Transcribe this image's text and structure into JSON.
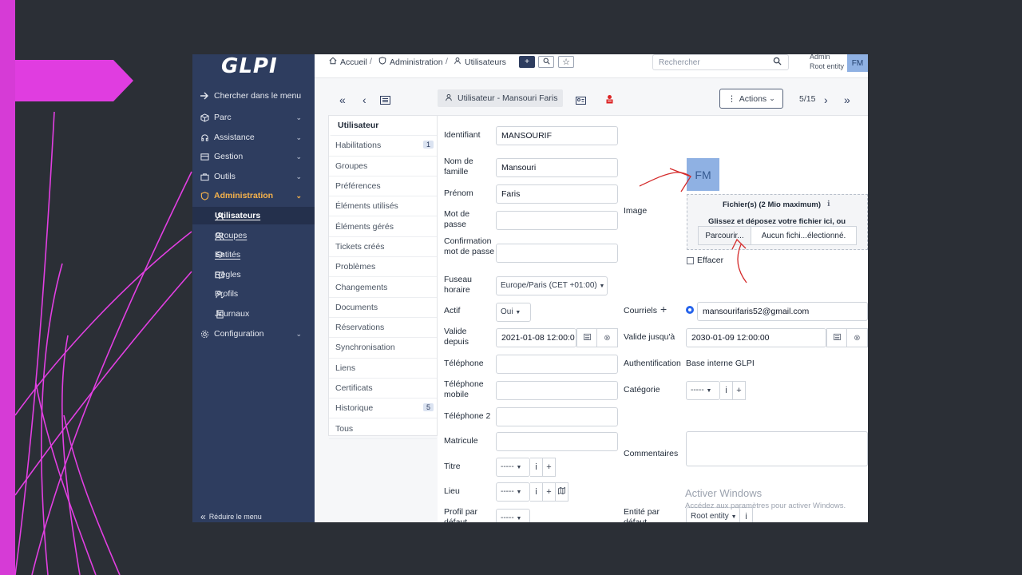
{
  "app": {
    "logo_text": "GLPI"
  },
  "sidebar": {
    "search_label": "Chercher dans le menu",
    "items": [
      {
        "label": "Parc"
      },
      {
        "label": "Assistance"
      },
      {
        "label": "Gestion"
      },
      {
        "label": "Outils"
      },
      {
        "label": "Administration"
      }
    ],
    "subitems": [
      {
        "label": "Utilisateurs"
      },
      {
        "label": "Groupes"
      },
      {
        "label": "Entités"
      },
      {
        "label": "Règles"
      },
      {
        "label": "Profils"
      },
      {
        "label": "Journaux"
      }
    ],
    "config_label": "Configuration",
    "collapse_label": "Réduire le menu"
  },
  "topbar": {
    "breadcrumb": [
      "Accueil",
      "Administration",
      "Utilisateurs"
    ],
    "add_icon": "+",
    "search_placeholder": "Rechercher",
    "user_name": "Admin",
    "user_entity": "Root entity",
    "avatar_initials": "FM"
  },
  "record": {
    "title": "Utilisateur - Mansouri Faris",
    "actions_label": "Actions",
    "pager": "5/15"
  },
  "tabs": [
    {
      "label": "Utilisateur",
      "badge": ""
    },
    {
      "label": "Habilitations",
      "badge": "1"
    },
    {
      "label": "Groupes",
      "badge": ""
    },
    {
      "label": "Préférences",
      "badge": ""
    },
    {
      "label": "Éléments utilisés",
      "badge": ""
    },
    {
      "label": "Éléments gérés",
      "badge": ""
    },
    {
      "label": "Tickets créés",
      "badge": ""
    },
    {
      "label": "Problèmes",
      "badge": ""
    },
    {
      "label": "Changements",
      "badge": ""
    },
    {
      "label": "Documents",
      "badge": ""
    },
    {
      "label": "Réservations",
      "badge": ""
    },
    {
      "label": "Synchronisation",
      "badge": ""
    },
    {
      "label": "Liens",
      "badge": ""
    },
    {
      "label": "Certificats",
      "badge": ""
    },
    {
      "label": "Historique",
      "badge": "5"
    },
    {
      "label": "Tous",
      "badge": ""
    }
  ],
  "form": {
    "identifiant_label": "Identifiant",
    "identifiant_value": "MANSOURIF",
    "nom_label": "Nom de famille",
    "nom_value": "Mansouri",
    "prenom_label": "Prénom",
    "prenom_value": "Faris",
    "mdp_label": "Mot de passe",
    "mdp_confirm_label": "Confirmation mot de passe",
    "fuseau_label": "Fuseau horaire",
    "fuseau_value": "Europe/Paris (CET +01:00)",
    "actif_label": "Actif",
    "actif_value": "Oui",
    "valide_depuis_label": "Valide depuis",
    "valide_depuis_value": "2021-01-08 12:00:0",
    "telephone_label": "Téléphone",
    "telephone_mobile_label": "Téléphone mobile",
    "telephone2_label": "Téléphone 2",
    "matricule_label": "Matricule",
    "titre_label": "Titre",
    "lieu_label": "Lieu",
    "profil_label": "Profil par défaut",
    "empty_select": "-----",
    "image_label": "Image",
    "avatar_initials": "FM",
    "files_title": "Fichier(s) (2 Mio maximum)",
    "drop_text": "Glissez et déposez votre fichier ici, ou",
    "browse_label": "Parcourir...",
    "no_file_label": "Aucun fichi...électionné.",
    "effacer_label": "Effacer",
    "courriels_label": "Courriels",
    "email_value": "mansourifaris52@gmail.com",
    "valide_jusqua_label": "Valide jusqu'à",
    "valide_jusqua_value": "2030-01-09 12:00:00",
    "auth_label": "Authentification",
    "auth_value": "Base interne GLPI",
    "categorie_label": "Catégorie",
    "commentaires_label": "Commentaires",
    "entite_label": "Entité par défaut",
    "entite_value": "Root entity"
  },
  "watermark": {
    "title": "Activer Windows",
    "subtitle": "Accédez aux paramètres pour activer Windows."
  },
  "colors": {
    "sidebar_bg": "#2e3d5f",
    "active_menu": "#f7b34b",
    "slide_bg": "#2b2f36",
    "accent_magenta": "#e040e0",
    "annotation_red": "#d42a2a"
  }
}
